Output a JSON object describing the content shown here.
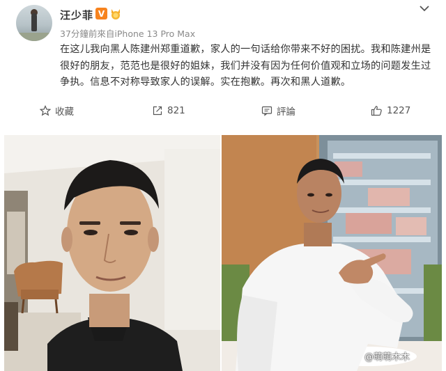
{
  "post": {
    "username": "汪少菲",
    "verified_badge": "V",
    "meta": "37分鐘前來自iPhone 13 Pro Max",
    "text": "在这儿我向黑人陈建州郑重道歉，家人的一句话给你带来不好的困扰。我和陈建州是很好的朋友，范范也是很好的姐妹，我们并没有因为任何价值观和立场的问题发生过争执。信息不对称导致家人的误解。实在抱歉。再次和黑人道歉。",
    "actions": {
      "favorite_label": "收藏",
      "repost_count": "821",
      "comment_label": "評論",
      "like_count": "1227"
    }
  },
  "watermark": "@萌萌木木",
  "icons": {
    "favorite": "star-icon",
    "repost": "share-arrow-icon",
    "comment": "comment-bubble-icon",
    "like": "thumbs-up-icon",
    "menu": "chevron-down-icon"
  },
  "colors": {
    "verified_badge": "#f7831e",
    "text": "#333333",
    "meta": "#8a8a8a"
  }
}
